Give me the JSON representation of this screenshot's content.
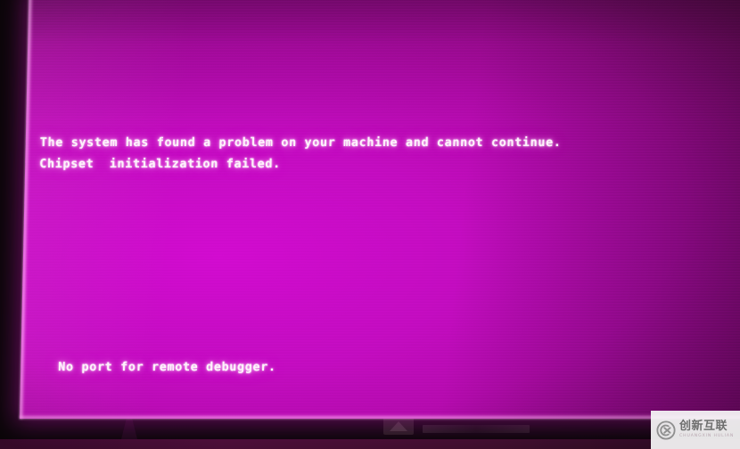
{
  "screen": {
    "kind": "bios-error-screen",
    "background_color": "#c30cc0",
    "text_color": "#fdf2fb",
    "messages": {
      "line1": "The system has found a problem on your machine and cannot continue.",
      "line2": "Chipset  initialization failed.",
      "line3": "No port for remote debugger."
    }
  },
  "monitor": {
    "bezel_color": "#0b0609",
    "bottom_strip_color": "#4b0f38",
    "brand_badge": "monitor-brand-badge"
  },
  "watermark": {
    "logo_icon": "circle-cx-logo-icon",
    "name_cn": "创新互联",
    "name_en": "CHUANGXIN HULIAN",
    "panel_color": "#f8f8f8"
  }
}
